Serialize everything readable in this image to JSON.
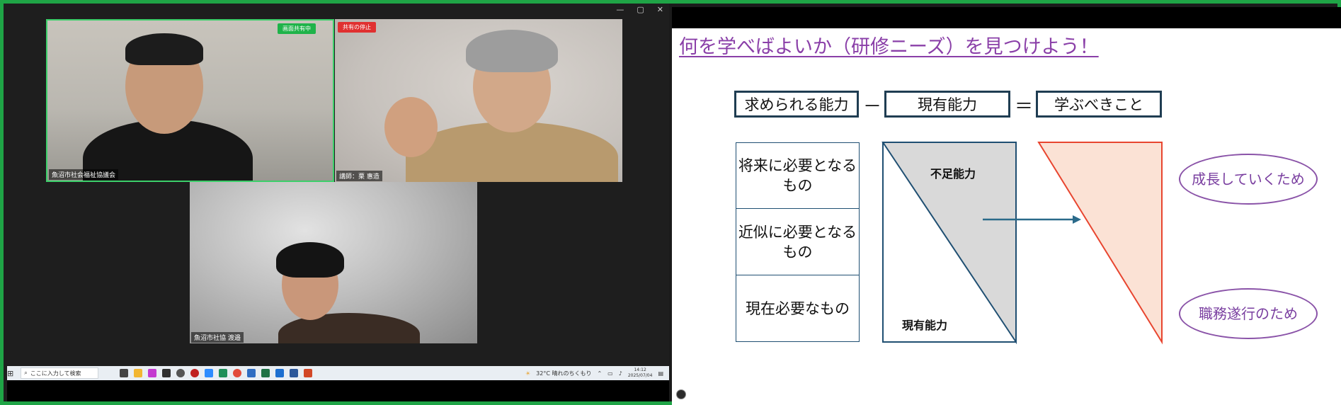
{
  "meeting": {
    "tiles": [
      {
        "name": "魚沼市社会福祉協議会",
        "badge": "画面共有中"
      },
      {
        "name": "講師：栗 惠造",
        "badge": "共有の停止"
      },
      {
        "name": "魚沼市社協 渡邉"
      }
    ]
  },
  "taskbar": {
    "search_placeholder": "ここに入力して検索",
    "weather": "32°C  晴れのちくもり",
    "time": "14:12",
    "date": "2025/07/04"
  },
  "slide": {
    "title": "何を学べばよいか（研修ニーズ）を見つけよう！",
    "equation": {
      "term1": "求められる能力",
      "minus": "－",
      "term2": "現有能力",
      "equals": "＝",
      "result": "学ぶべきこと"
    },
    "rows": [
      "将来に必要となるもの",
      "近似に必要となるもの",
      "現在必要なもの"
    ],
    "triangle_labels": {
      "shortfall": "不足能力",
      "current": "現有能力"
    },
    "ovals": [
      "成長していくため",
      "職務遂行のため"
    ]
  },
  "colors": {
    "title": "#8a3fa8",
    "box_border": "#1f3d52",
    "triangle_fill": "#d9d9d9",
    "orange_fill": "#fbe2d5",
    "orange_stroke": "#e8452f",
    "arrow": "#2a6a8a",
    "oval": "#8a53a8",
    "frame": "#1fa446"
  }
}
